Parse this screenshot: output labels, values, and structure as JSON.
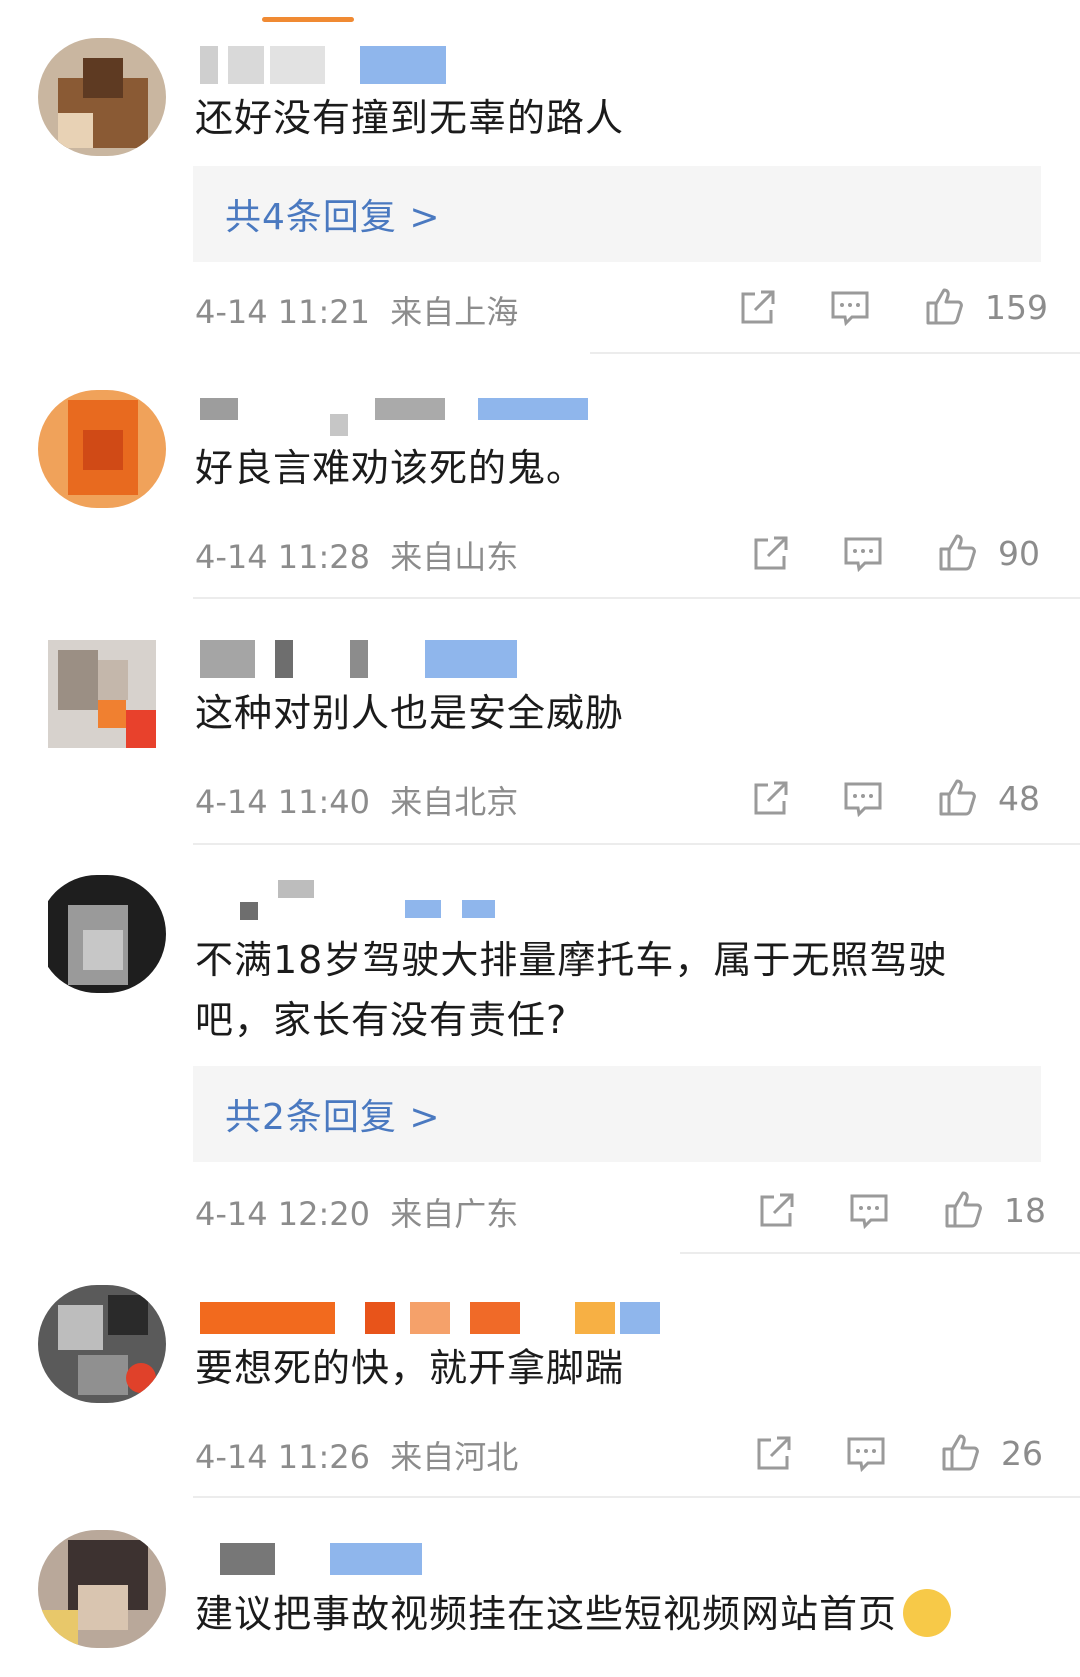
{
  "comments": [
    {
      "text": "还好没有撞到无辜的路人",
      "replies": "共4条回复 >",
      "time": "4-14 11:21",
      "location": "来自上海",
      "likes": "159"
    },
    {
      "text": "好良言难劝该死的鬼。",
      "replies": "",
      "time": "4-14 11:28",
      "location": "来自山东",
      "likes": "90"
    },
    {
      "text": "这种对别人也是安全威胁",
      "replies": "",
      "time": "4-14 11:40",
      "location": "来自北京",
      "likes": "48"
    },
    {
      "text_line1": "不满18岁驾驶大排量摩托车，属于无照驾驶",
      "text_line2": "吧，家长有没有责任?",
      "replies": "共2条回复 >",
      "time": "4-14 12:20",
      "location": "来自广东",
      "likes": "18"
    },
    {
      "text": "要想死的快，就开拿脚踹",
      "replies": "",
      "time": "4-14 11:26",
      "location": "来自河北",
      "likes": "26"
    },
    {
      "text": "建议把事故视频挂在这些短视频网站首页",
      "emoji": "smirk-emoji"
    }
  ],
  "icons": {
    "share": "share-icon",
    "comment": "comment-icon",
    "like": "thumbs-up-icon"
  },
  "colors": {
    "reply_link": "#4a79c0",
    "meta": "#8c8c8c",
    "accent": "#f08a33"
  }
}
